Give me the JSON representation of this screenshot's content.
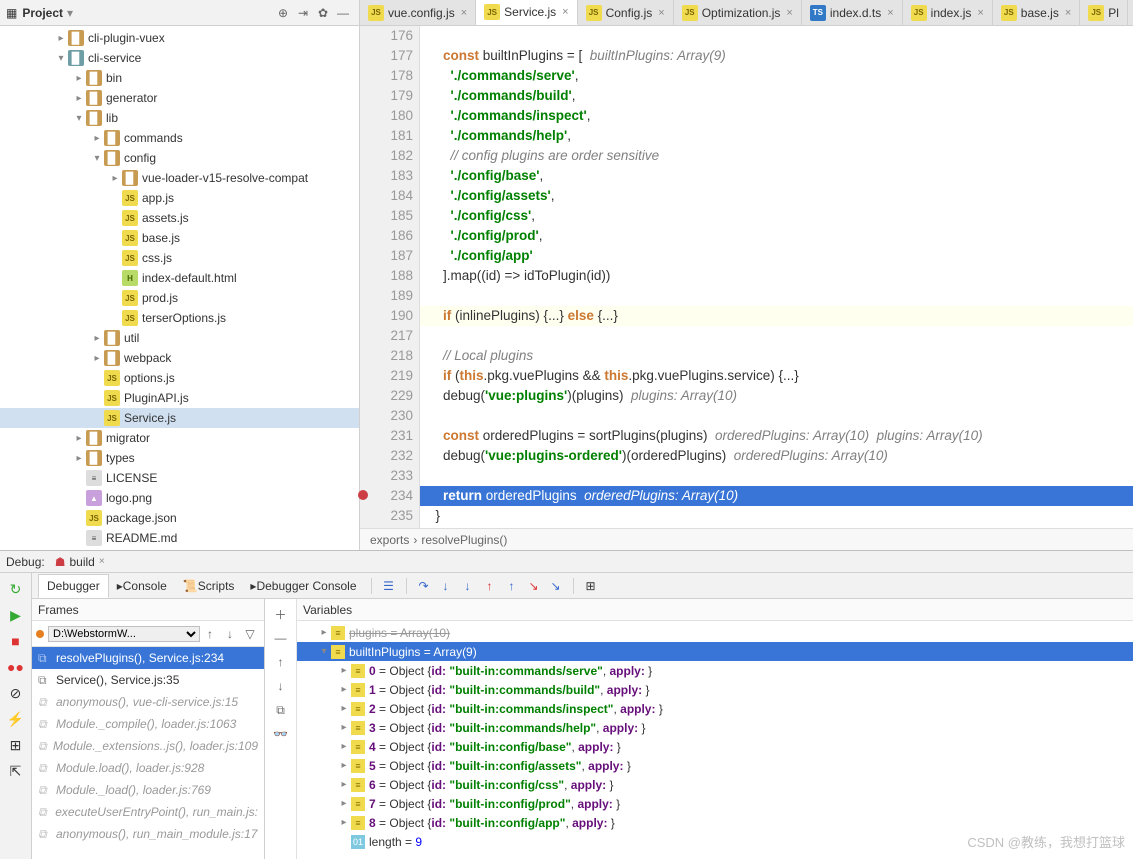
{
  "project_header": {
    "title": "Project"
  },
  "tree": [
    {
      "depth": 3,
      "arrow": ">",
      "icon": "folder",
      "label": "cli-plugin-vuex",
      "icon_style": "folder"
    },
    {
      "depth": 3,
      "arrow": "v",
      "icon": "folder-o",
      "label": "cli-service"
    },
    {
      "depth": 4,
      "arrow": ">",
      "icon": "folder",
      "label": "bin"
    },
    {
      "depth": 4,
      "arrow": ">",
      "icon": "folder",
      "label": "generator"
    },
    {
      "depth": 4,
      "arrow": "v",
      "icon": "folder",
      "label": "lib"
    },
    {
      "depth": 5,
      "arrow": ">",
      "icon": "folder",
      "label": "commands"
    },
    {
      "depth": 5,
      "arrow": "v",
      "icon": "folder",
      "label": "config"
    },
    {
      "depth": 6,
      "arrow": ">",
      "icon": "folder",
      "label": "vue-loader-v15-resolve-compat"
    },
    {
      "depth": 6,
      "arrow": "",
      "icon": "js",
      "label": "app.js"
    },
    {
      "depth": 6,
      "arrow": "",
      "icon": "js",
      "label": "assets.js"
    },
    {
      "depth": 6,
      "arrow": "",
      "icon": "js",
      "label": "base.js"
    },
    {
      "depth": 6,
      "arrow": "",
      "icon": "js",
      "label": "css.js"
    },
    {
      "depth": 6,
      "arrow": "",
      "icon": "html",
      "label": "index-default.html"
    },
    {
      "depth": 6,
      "arrow": "",
      "icon": "js",
      "label": "prod.js"
    },
    {
      "depth": 6,
      "arrow": "",
      "icon": "js",
      "label": "terserOptions.js"
    },
    {
      "depth": 5,
      "arrow": ">",
      "icon": "folder",
      "label": "util"
    },
    {
      "depth": 5,
      "arrow": ">",
      "icon": "folder",
      "label": "webpack"
    },
    {
      "depth": 5,
      "arrow": "",
      "icon": "js",
      "label": "options.js"
    },
    {
      "depth": 5,
      "arrow": "",
      "icon": "js",
      "label": "PluginAPI.js"
    },
    {
      "depth": 5,
      "arrow": "",
      "icon": "js",
      "label": "Service.js",
      "selected": true
    },
    {
      "depth": 4,
      "arrow": ">",
      "icon": "folder",
      "label": "migrator"
    },
    {
      "depth": 4,
      "arrow": ">",
      "icon": "folder",
      "label": "types"
    },
    {
      "depth": 4,
      "arrow": "",
      "icon": "txt",
      "label": "LICENSE"
    },
    {
      "depth": 4,
      "arrow": "",
      "icon": "png",
      "label": "logo.png"
    },
    {
      "depth": 4,
      "arrow": "",
      "icon": "js",
      "label": "package.json"
    },
    {
      "depth": 4,
      "arrow": "",
      "icon": "txt",
      "label": "README.md"
    }
  ],
  "tabs": [
    {
      "icon": "js",
      "label": "vue.config.js",
      "close": true
    },
    {
      "icon": "js",
      "label": "Service.js",
      "close": true,
      "active": true
    },
    {
      "icon": "js",
      "label": "Config.js",
      "close": true
    },
    {
      "icon": "js",
      "label": "Optimization.js",
      "close": true
    },
    {
      "icon": "ts",
      "label": "index.d.ts",
      "close": true
    },
    {
      "icon": "js",
      "label": "index.js",
      "close": true
    },
    {
      "icon": "js",
      "label": "base.js",
      "close": true
    },
    {
      "icon": "js",
      "label": "Pl"
    }
  ],
  "code_lines": [
    {
      "n": 176,
      "html": ""
    },
    {
      "n": 177,
      "html": "    <span class='kw'>const</span> builtInPlugins = [  <span class='it'>builtInPlugins: Array(9)</span>"
    },
    {
      "n": 178,
      "html": "      <span class='str'>'./commands/serve'</span>,"
    },
    {
      "n": 179,
      "html": "      <span class='str'>'./commands/build'</span>,"
    },
    {
      "n": 180,
      "html": "      <span class='str'>'./commands/inspect'</span>,"
    },
    {
      "n": 181,
      "html": "      <span class='str'>'./commands/help'</span>,"
    },
    {
      "n": 182,
      "html": "      <span class='cm'>// config plugins are order sensitive</span>"
    },
    {
      "n": 183,
      "html": "      <span class='str'>'./config/base'</span>,"
    },
    {
      "n": 184,
      "html": "      <span class='str'>'./config/assets'</span>,"
    },
    {
      "n": 185,
      "html": "      <span class='str'>'./config/css'</span>,"
    },
    {
      "n": 186,
      "html": "      <span class='str'>'./config/prod'</span>,"
    },
    {
      "n": 187,
      "html": "      <span class='str'>'./config/app'</span>"
    },
    {
      "n": 188,
      "html": "    ].map((id) =&gt; idToPlugin(id))"
    },
    {
      "n": 189,
      "html": ""
    },
    {
      "n": 190,
      "html": "    <span class='kw'>if</span> (inlinePlugins) {...} <span class='kw'>else</span> {...}",
      "hl": true
    },
    {
      "n": 217,
      "html": ""
    },
    {
      "n": 218,
      "html": "    <span class='cm'>// Local plugins</span>"
    },
    {
      "n": 219,
      "html": "    <span class='kw'>if</span> (<span class='kw'>this</span>.pkg.vuePlugins &amp;&amp; <span class='kw'>this</span>.pkg.vuePlugins.service) {...}"
    },
    {
      "n": 229,
      "html": "    debug(<span class='str'>'vue:plugins'</span>)(plugins)  <span class='it'>plugins: Array(10)</span>"
    },
    {
      "n": 230,
      "html": ""
    },
    {
      "n": 231,
      "html": "    <span class='kw'>const</span> orderedPlugins = sortPlugins(plugins)  <span class='it'>orderedPlugins: Array(10)  plugins: Array(10)</span>"
    },
    {
      "n": 232,
      "html": "    debug(<span class='str'>'vue:plugins-ordered'</span>)(orderedPlugins)  <span class='it'>orderedPlugins: Array(10)</span>"
    },
    {
      "n": 233,
      "html": ""
    },
    {
      "n": 234,
      "html": "    <span class='kw'>return</span> orderedPlugins  <span class='it'>orderedPlugins: Array(10)</span>",
      "exec": true,
      "bp": true
    },
    {
      "n": 235,
      "html": "  }"
    }
  ],
  "breadcrumb": [
    "exports",
    "resolvePlugins()"
  ],
  "debug": {
    "title": "Debug:",
    "config": "build",
    "tabs": [
      "Debugger",
      "Console",
      "Scripts",
      "Debugger Console"
    ],
    "frames_label": "Frames",
    "vars_label": "Variables",
    "thread": "D:\\WebstormW...",
    "frames": [
      {
        "label": "resolvePlugins(), Service.js:234",
        "sel": true
      },
      {
        "label": "Service(), Service.js:35"
      },
      {
        "label": "anonymous(), vue-cli-service.js:15",
        "muted": true
      },
      {
        "label": "Module._compile(), loader.js:1063",
        "muted": true
      },
      {
        "label": "Module._extensions..js(), loader.js:109",
        "muted": true
      },
      {
        "label": "Module.load(), loader.js:928",
        "muted": true
      },
      {
        "label": "Module._load(), loader.js:769",
        "muted": true
      },
      {
        "label": "executeUserEntryPoint(), run_main.js:",
        "muted": true
      },
      {
        "label": "anonymous(), run_main_module.js:17",
        "muted": true
      }
    ],
    "vars_root": {
      "label": "builtInPlugins = Array(9)"
    },
    "vars": [
      {
        "idx": "0",
        "id": "built-in:commands/serve"
      },
      {
        "idx": "1",
        "id": "built-in:commands/build"
      },
      {
        "idx": "2",
        "id": "built-in:commands/inspect"
      },
      {
        "idx": "3",
        "id": "built-in:commands/help"
      },
      {
        "idx": "4",
        "id": "built-in:config/base"
      },
      {
        "idx": "5",
        "id": "built-in:config/assets"
      },
      {
        "idx": "6",
        "id": "built-in:config/css"
      },
      {
        "idx": "7",
        "id": "built-in:config/prod"
      },
      {
        "idx": "8",
        "id": "built-in:config/app"
      }
    ],
    "length_label": "length = ",
    "length_val": "9"
  },
  "watermark": "CSDN @教练，我想打篮球"
}
